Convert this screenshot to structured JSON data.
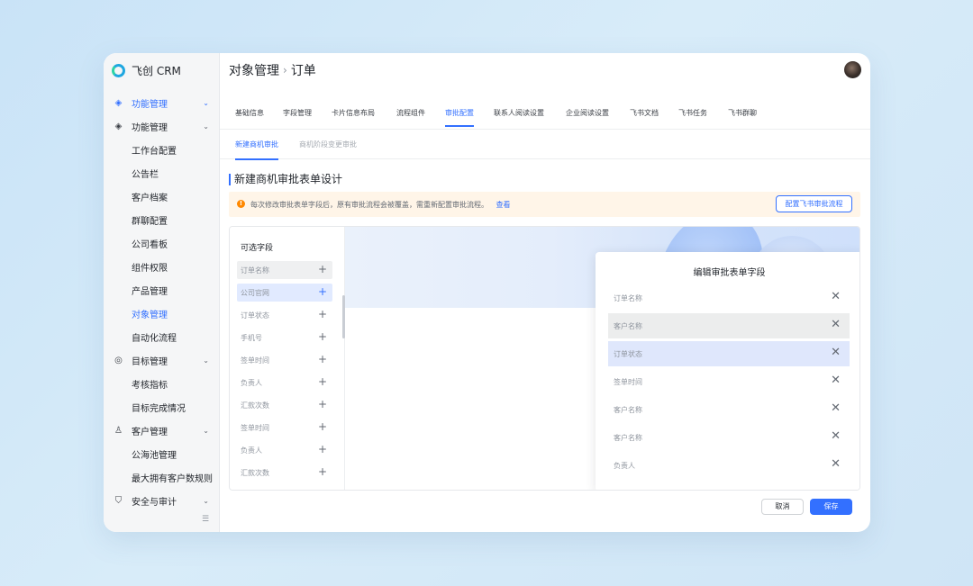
{
  "app": {
    "name": "飞创 CRM"
  },
  "sidebar": {
    "items": [
      {
        "label": "功能管理",
        "icon": "layers-icon",
        "chevron": "⌄",
        "kind": "top",
        "state": "active-top"
      },
      {
        "label": "功能管理",
        "icon": "layers-icon",
        "chevron": "⌄",
        "kind": "top",
        "state": ""
      },
      {
        "label": "工作台配置",
        "kind": "sub",
        "state": ""
      },
      {
        "label": "公告栏",
        "kind": "sub",
        "state": ""
      },
      {
        "label": "客户档案",
        "kind": "sub",
        "state": ""
      },
      {
        "label": "群聊配置",
        "kind": "sub",
        "state": ""
      },
      {
        "label": "公司看板",
        "kind": "sub",
        "state": ""
      },
      {
        "label": "组件权限",
        "kind": "sub",
        "state": ""
      },
      {
        "label": "产品管理",
        "kind": "sub",
        "state": ""
      },
      {
        "label": "对象管理",
        "kind": "sub",
        "state": "active"
      },
      {
        "label": "自动化流程",
        "kind": "sub",
        "state": ""
      },
      {
        "label": "目标管理",
        "icon": "target-icon",
        "chevron": "⌄",
        "kind": "top",
        "state": ""
      },
      {
        "label": "考核指标",
        "kind": "sub",
        "state": ""
      },
      {
        "label": "目标完成情况",
        "kind": "sub",
        "state": ""
      },
      {
        "label": "客户管理",
        "icon": "user-icon",
        "chevron": "⌄",
        "kind": "top",
        "state": ""
      },
      {
        "label": "公海池管理",
        "kind": "sub",
        "state": ""
      },
      {
        "label": "最大拥有客户数规则",
        "kind": "sub",
        "state": ""
      },
      {
        "label": "安全与审计",
        "icon": "shield-icon",
        "chevron": "⌄",
        "kind": "top",
        "state": ""
      }
    ]
  },
  "header": {
    "breadcrumb": [
      "对象管理",
      "订单"
    ],
    "separator": "›"
  },
  "tabs": [
    {
      "label": "基础信息",
      "active": false
    },
    {
      "label": "字段管理",
      "active": false
    },
    {
      "label": "卡片信息布局",
      "active": false
    },
    {
      "label": "流程组件",
      "active": false
    },
    {
      "label": "审批配置",
      "active": true
    },
    {
      "label": "联系人阅读设置",
      "active": false
    },
    {
      "label": "企业阅读设置",
      "active": false
    },
    {
      "label": "飞书文档",
      "active": false
    },
    {
      "label": "飞书任务",
      "active": false
    },
    {
      "label": "飞书群聊",
      "active": false
    }
  ],
  "subtabs": [
    {
      "label": "新建商机审批",
      "active": true
    },
    {
      "label": "商机阶段变更审批",
      "active": false
    }
  ],
  "section": {
    "title": "新建商机审批表单设计"
  },
  "notice": {
    "icon": "!",
    "text": "每次修改审批表单字段后，原有审批流程会被覆盖，需重新配置审批流程。",
    "link": "查看",
    "button": "配置飞书审批流程"
  },
  "fields_panel": {
    "title": "可选字段",
    "items": [
      {
        "label": "订单名称",
        "state": "hover"
      },
      {
        "label": "公司官网",
        "state": "selected"
      },
      {
        "label": "订单状态",
        "state": ""
      },
      {
        "label": "手机号",
        "state": ""
      },
      {
        "label": "签单时间",
        "state": ""
      },
      {
        "label": "负责人",
        "state": ""
      },
      {
        "label": "汇款次数",
        "state": ""
      },
      {
        "label": "签单时间",
        "state": ""
      },
      {
        "label": "负责人",
        "state": ""
      },
      {
        "label": "汇款次数",
        "state": ""
      }
    ],
    "add_symbol": "+"
  },
  "dialog": {
    "title": "编辑审批表单字段",
    "remove_symbol": "✕",
    "rows": [
      {
        "label": "订单名称",
        "state": ""
      },
      {
        "label": "客户名称",
        "state": "hover"
      },
      {
        "label": "订单状态",
        "state": "selected"
      },
      {
        "label": "签单时间",
        "state": ""
      },
      {
        "label": "客户名称",
        "state": ""
      },
      {
        "label": "客户名称",
        "state": ""
      },
      {
        "label": "负责人",
        "state": ""
      }
    ]
  },
  "footer": {
    "cancel": "取消",
    "save": "保存"
  },
  "colors": {
    "accent": "#3370ff",
    "notice_bg": "#fff5e8",
    "notice_icon": "#ff8800"
  }
}
